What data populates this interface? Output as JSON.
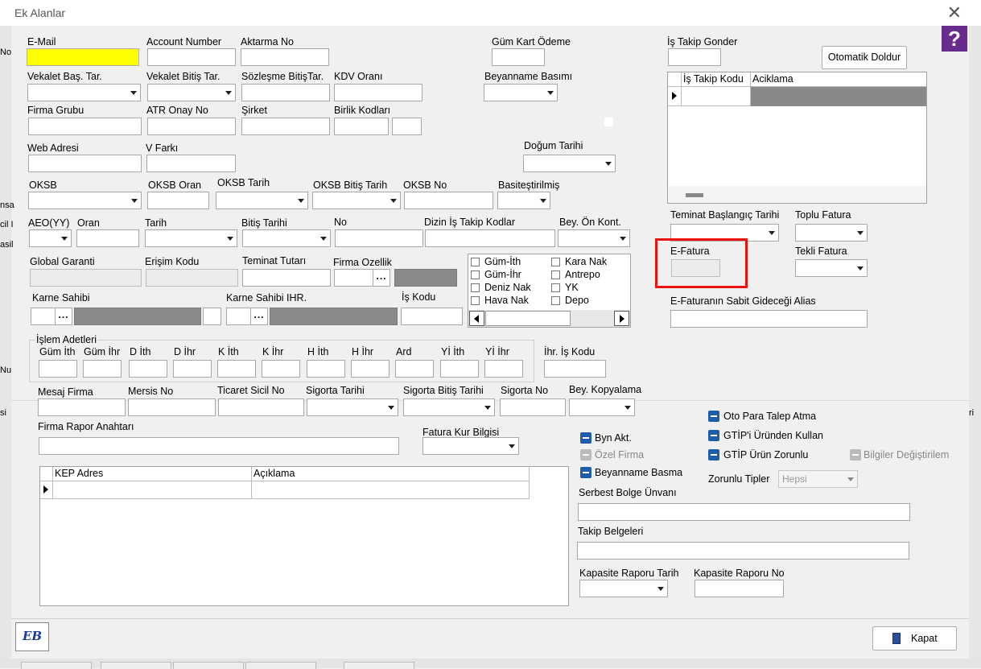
{
  "window": {
    "title": "Ek Alanlar",
    "close": "✕",
    "help": "?"
  },
  "background_fragments": [
    "No",
    "nsa",
    "cil I",
    "asil",
    "Nu",
    "si",
    "ri"
  ],
  "labels": {
    "email": "E-Mail",
    "account_number": "Account Number",
    "aktarma_no": "Aktarma No",
    "gum_kart_odeme": "Güm Kart Ödeme",
    "is_takip_gonder": "İş Takip Gonder",
    "vekalet_bas": "Vekalet Baş. Tar.",
    "vekalet_bitis": "Vekalet Bitiş Tar.",
    "sozlesme_bitis": "Sözleşme BitişTar.",
    "kdv_orani": "KDV Oranı",
    "beyanname_basimi": "Beyanname Basımı",
    "firma_grubu": "Firma Grubu",
    "atr_onay": "ATR Onay No",
    "sirket": "Şirket",
    "birlik_kodlari": "Birlik Kodları",
    "web_adresi": "Web Adresi",
    "v_farki": "V Farkı",
    "dogum_tarihi": "Doğum Tarihi",
    "oksb": "OKSB",
    "oksb_oran": "OKSB Oran",
    "oksb_tarih": "OKSB Tarih",
    "oksb_bitis": "OKSB Bitiş Tarih",
    "oksb_no": "OKSB No",
    "basitestirilmis": "Basiteştirilmiş",
    "aeo": "AEO(YY)",
    "oran": "Oran",
    "tarih": "Tarih",
    "bitis_tarihi": "Bitiş Tarihi",
    "no": "No",
    "dizin": "Dizin İş Takip Kodlar",
    "bey_on_kont": "Bey. Ön Kont.",
    "teminat_baslangic": "Teminat Başlangıç Tarihi",
    "toplu_fatura": "Toplu Fatura",
    "global_garanti": "Global Garanti",
    "erisim_kodu": "Erişim Kodu",
    "teminat_tutari": "Teminat Tutarı",
    "firma_ozellik": "Firma Ozellik",
    "e_fatura": "E-Fatura",
    "tekli_fatura": "Tekli Fatura",
    "karne_sahibi": "Karne Sahibi",
    "karne_sahibi_ihr": "Karne Sahibi IHR.",
    "is_kodu": "İş Kodu",
    "efatura_alias": "E-Faturanın Sabit Gideceği Alias",
    "islem_adetleri": "İşlem Adetleri",
    "ihr_is_kodu": "İhr. İş Kodu",
    "mesaj_firma": "Mesaj Firma",
    "mersis_no": "Mersis No",
    "ticaret_sicil": "Ticaret Sicil No",
    "sigorta_tarihi": "Sigorta Tarihi",
    "sigorta_bitis": "Sigorta Bitiş Tarihi",
    "sigorta_no": "Sigorta No",
    "bey_kopyalama": "Bey. Kopyalama",
    "firma_rapor": "Firma Rapor Anahtarı",
    "fatura_kur": "Fatura Kur Bilgisi",
    "serbest_bolge": "Serbest Bolge Ünvanı",
    "takip_belgeleri": "Takip Belgeleri",
    "kapasite_tarih": "Kapasite Raporu Tarih",
    "kapasite_no": "Kapasite Raporu No",
    "zorunlu_tipler": "Zorunlu Tipler"
  },
  "islem_columns": [
    "Güm İth",
    "Güm İhr",
    "D İth",
    "D İhr",
    "K İth",
    "K İhr",
    "H İth",
    "H İhr",
    "Ard",
    "Yİ İth",
    "Yİ İhr"
  ],
  "is_takip_grid": {
    "headers": [
      "İş Takip Kodu",
      "Aciklama"
    ]
  },
  "kep_grid": {
    "headers": [
      "KEP Adres",
      "Açıklama"
    ]
  },
  "check_list": {
    "left": [
      "Güm-İth",
      "Güm-İhr",
      "Deniz Nak",
      "Hava Nak"
    ],
    "right": [
      "Kara Nak",
      "Antrepo",
      "YK",
      "Depo"
    ]
  },
  "toggles": {
    "oto_para": "Oto Para Talep Atma",
    "gtip_kullan": "GTİP'i Üründen Kullan",
    "gtip_zorunlu": "GTİP Ürün Zorunlu",
    "bilgiler": "Bilgiler Değiştirilem",
    "byn_akt": "Byn Akt.",
    "ozel_firma": "Özel Firma",
    "beyanname_basma": "Beyanname Basma"
  },
  "zorunlu_tipler_value": "Hepsi",
  "buttons": {
    "otomatik": "Otomatik Doldur",
    "kapat": "Kapat",
    "ellipsis": "..."
  },
  "logo_text": "EB",
  "colors": {
    "highlight": "#ee1111",
    "email_bg": "#ffff00",
    "toggle_blue": "#1e5ea8"
  }
}
